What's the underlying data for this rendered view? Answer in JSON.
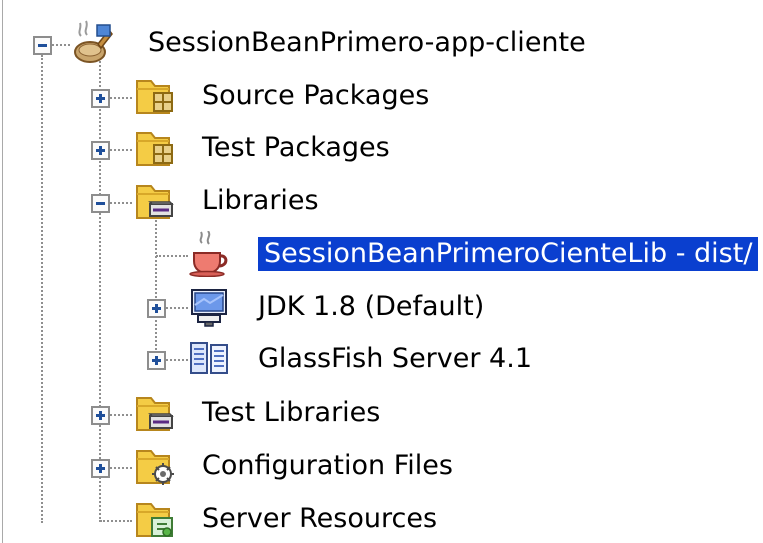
{
  "tree": {
    "root": {
      "label": "SessionBeanPrimero-app-cliente",
      "icon": "project-coffee-icon",
      "expanded": true
    },
    "children": [
      {
        "label": "Source Packages",
        "icon": "source-packages-folder-icon",
        "expanded": false
      },
      {
        "label": "Test Packages",
        "icon": "test-packages-folder-icon",
        "expanded": false
      },
      {
        "label": "Libraries",
        "icon": "libraries-folder-icon",
        "expanded": true,
        "children": [
          {
            "label": "SessionBeanPrimeroCienteLib - dist/",
            "icon": "java-coffee-icon",
            "selected": true
          },
          {
            "label": "JDK 1.8 (Default)",
            "icon": "jdk-computer-icon",
            "expanded": false
          },
          {
            "label": "GlassFish Server 4.1",
            "icon": "server-icon",
            "expanded": false
          }
        ]
      },
      {
        "label": "Test Libraries",
        "icon": "test-libraries-folder-icon",
        "expanded": false
      },
      {
        "label": "Configuration Files",
        "icon": "configuration-folder-icon",
        "expanded": false
      },
      {
        "label": "Server Resources",
        "icon": "server-resources-folder-icon",
        "expanded": null
      }
    ],
    "colors": {
      "selection_background": "#0a3fcf",
      "selection_text": "#ffffff",
      "folder_yellow": "#f4cc45",
      "expander_blue": "#1f4f9a"
    }
  }
}
